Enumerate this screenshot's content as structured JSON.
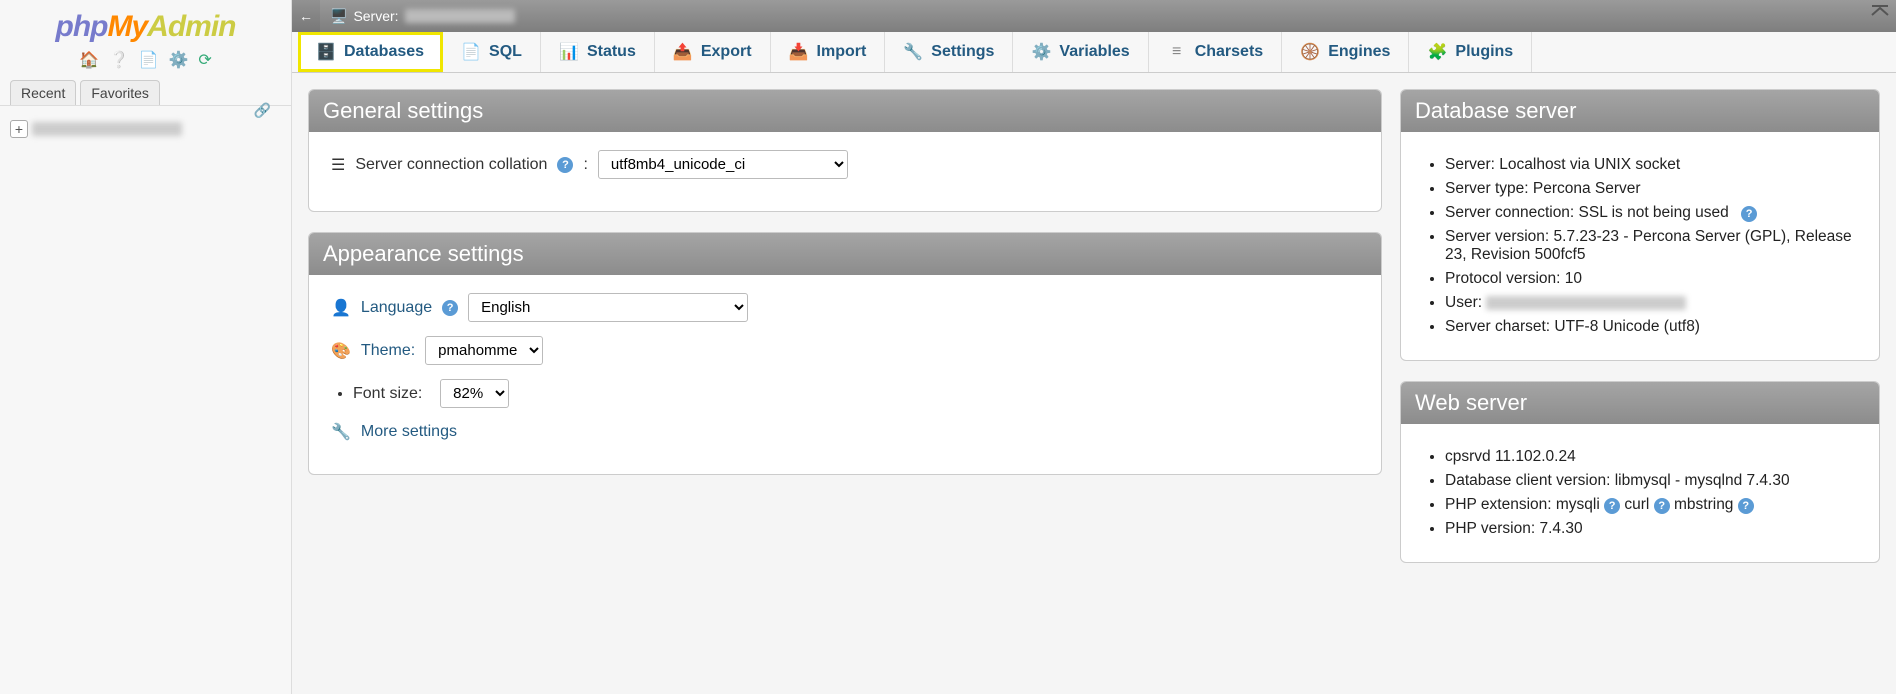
{
  "app": {
    "name_parts": [
      "php",
      "My",
      "Admin"
    ]
  },
  "sidebar": {
    "recent_label": "Recent",
    "favorites_label": "Favorites"
  },
  "breadcrumb": {
    "server_label": "Server:"
  },
  "tabs": [
    {
      "id": "databases",
      "label": "Databases",
      "icon": "🗄️"
    },
    {
      "id": "sql",
      "label": "SQL",
      "icon": "📄"
    },
    {
      "id": "status",
      "label": "Status",
      "icon": "📊"
    },
    {
      "id": "export",
      "label": "Export",
      "icon": "📤"
    },
    {
      "id": "import",
      "label": "Import",
      "icon": "📥"
    },
    {
      "id": "settings",
      "label": "Settings",
      "icon": "🔧"
    },
    {
      "id": "variables",
      "label": "Variables",
      "icon": "⚙️"
    },
    {
      "id": "charsets",
      "label": "Charsets",
      "icon": "≡"
    },
    {
      "id": "engines",
      "label": "Engines",
      "icon": "🛞"
    },
    {
      "id": "plugins",
      "label": "Plugins",
      "icon": "🧩"
    }
  ],
  "general": {
    "title": "General settings",
    "collation_label": "Server connection collation",
    "collation_value": "utf8mb4_unicode_ci"
  },
  "appearance": {
    "title": "Appearance settings",
    "language_label": "Language",
    "language_value": "English",
    "theme_label": "Theme:",
    "theme_value": "pmahomme",
    "fontsize_label": "Font size:",
    "fontsize_value": "82%",
    "more_settings": "More settings"
  },
  "db_server": {
    "title": "Database server",
    "items": [
      "Server: Localhost via UNIX socket",
      "Server type: Percona Server",
      "Server connection: SSL is not being used",
      "Server version: 5.7.23-23 - Percona Server (GPL), Release 23, Revision 500fcf5",
      "Protocol version: 10",
      "User:",
      "Server charset: UTF-8 Unicode (utf8)"
    ]
  },
  "web_server": {
    "title": "Web server",
    "items": [
      "cpsrvd 11.102.0.24",
      "Database client version: libmysql - mysqlnd 7.4.30",
      "PHP extension: mysqli  curl  mbstring",
      "PHP version: 7.4.30"
    ]
  }
}
